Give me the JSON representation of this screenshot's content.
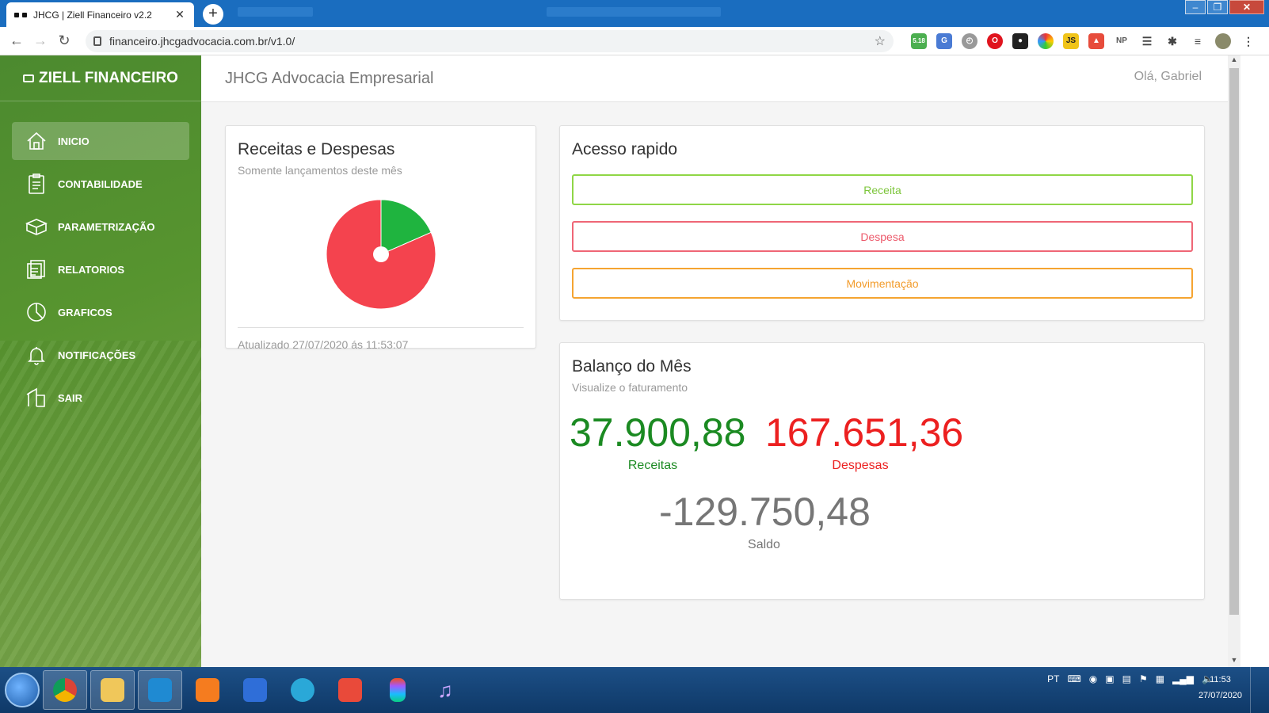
{
  "browser": {
    "tab_title": "JHCG | Ziell Financeiro v2.2",
    "url": "financeiro.jhcgadvocacia.com.br/v1.0/",
    "ext_badge": "5.18"
  },
  "sidebar": {
    "brand": "ZIELL FINANCEIRO",
    "items": [
      {
        "label": "INICIO",
        "icon": "home-icon"
      },
      {
        "label": "CONTABILIDADE",
        "icon": "clipboard-icon"
      },
      {
        "label": "PARAMETRIZAÇÃO",
        "icon": "box-icon"
      },
      {
        "label": "RELATORIOS",
        "icon": "report-icon"
      },
      {
        "label": "GRAFICOS",
        "icon": "pie-chart-icon"
      },
      {
        "label": "NOTIFICAÇÕES",
        "icon": "bell-icon"
      },
      {
        "label": "SAIR",
        "icon": "exit-icon"
      }
    ]
  },
  "header": {
    "company": "JHCG Advocacia Empresarial",
    "greeting": "Olá, Gabriel"
  },
  "receitas_despesas": {
    "title": "Receitas e Despesas",
    "subtitle": "Somente lançamentos deste mês",
    "updated": "Atualizado 27/07/2020 ás 11:53:07"
  },
  "chart_data": {
    "type": "pie",
    "slices": [
      {
        "label": "Receitas",
        "value": 37900.88,
        "color": "#1fb43f"
      },
      {
        "label": "Despesas",
        "value": 167651.36,
        "color": "#f4434e"
      }
    ]
  },
  "acesso": {
    "title": "Acesso rapido",
    "receita": "Receita",
    "despesa": "Despesa",
    "movimentacao": "Movimentação"
  },
  "balanco": {
    "title": "Balanço do Mês",
    "subtitle": "Visualize o faturamento",
    "receitas_value": "37.900,88",
    "receitas_label": "Receitas",
    "despesas_value": "167.651,36",
    "despesas_label": "Despesas",
    "saldo_value": "-129.750,48",
    "saldo_label": "Saldo"
  },
  "taskbar": {
    "lang": "PT",
    "time": "11:53",
    "date": "27/07/2020"
  },
  "colors": {
    "sidebar_green": "#57942f",
    "receita_green": "#1b8a22",
    "despesa_red": "#ec2020",
    "saldo_gray": "#767676"
  }
}
